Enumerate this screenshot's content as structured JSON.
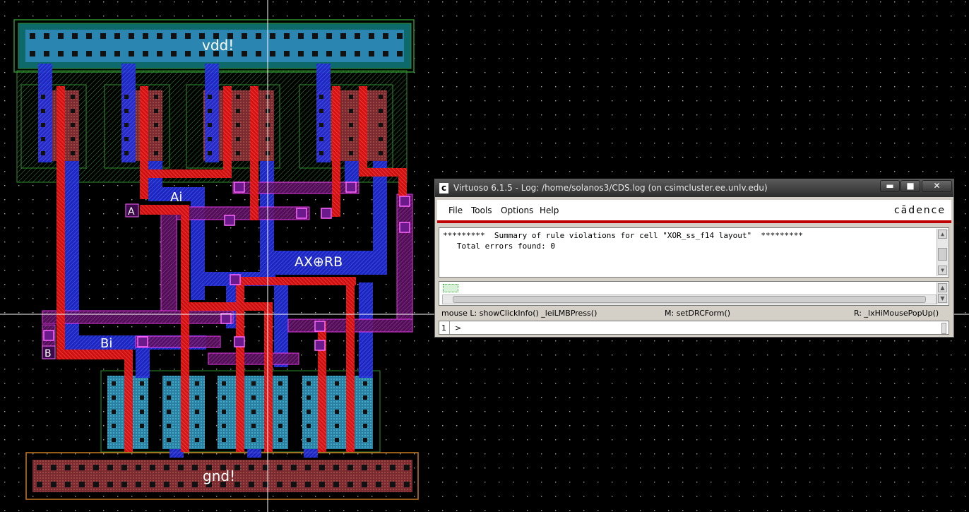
{
  "layout_view": {
    "labels": {
      "vdd": "vdd!",
      "gnd": "gnd!",
      "a_pin": "A",
      "ai": "Ai",
      "b_pin": "B",
      "bi": "Bi",
      "output": "AX⊕RB"
    },
    "colors": {
      "background": "#000000",
      "grid_dot": "#b0b0b0",
      "metal1": "#2a36ff",
      "poly": "#ff1a1a",
      "active": "#2aa0b0",
      "metal2": "#ff40ff",
      "contact": "#ff66ff",
      "nwell": "#2f8f2f",
      "pselect": "#c77a20",
      "crosshair": "#ffffff"
    }
  },
  "log_window": {
    "title": "Virtuoso 6.1.5 - Log: /home/solanos3/CDS.log (on csimcluster.ee.unlv.edu)",
    "title_icon": "c",
    "buttons": {
      "minimize": "▬",
      "maximize": "■",
      "close": "✕"
    },
    "menu": {
      "file": "File",
      "tools": "Tools",
      "options": "Options",
      "help": "Help"
    },
    "brand": "cādence",
    "output_lines": [
      "*********  Summary of rule violations for cell \"XOR_ss_f14 layout\"  *********",
      "   Total errors found: 0"
    ],
    "mouse": {
      "left": "mouse L: showClickInfo() _leiLMBPress()",
      "middle": "M: setDRCForm()",
      "right": "R: _lxHiMousePopUp()"
    },
    "command": {
      "line_number": "1",
      "prompt": ">"
    }
  }
}
